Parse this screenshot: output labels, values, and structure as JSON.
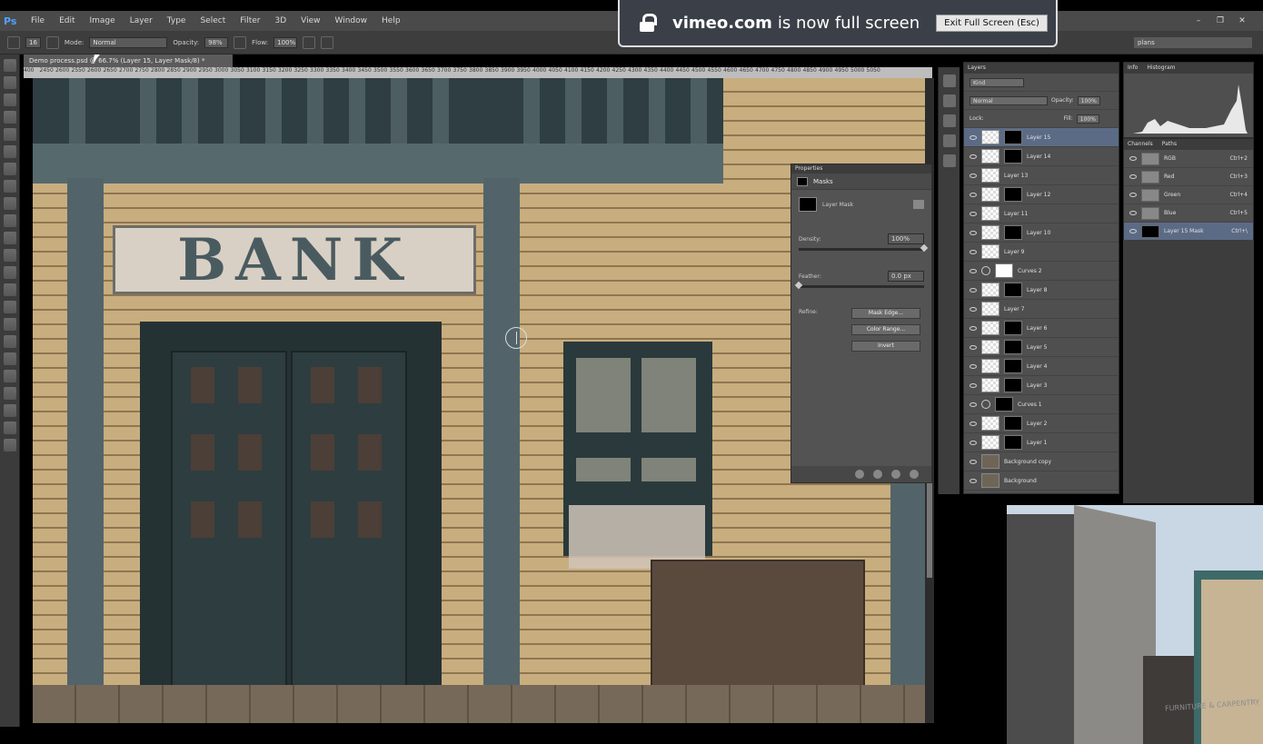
{
  "app": {
    "logo": "Ps",
    "menu": [
      "File",
      "Edit",
      "Image",
      "Layer",
      "Type",
      "Select",
      "Filter",
      "3D",
      "View",
      "Window",
      "Help"
    ],
    "window_controls": [
      "–",
      "❐",
      "✕"
    ]
  },
  "options_bar": {
    "brush_size": "16",
    "mode_label": "Mode:",
    "mode_value": "Normal",
    "opacity_label": "Opacity:",
    "opacity_value": "98%",
    "flow_label": "Flow:",
    "flow_value": "100%",
    "workspace": "plans"
  },
  "document": {
    "tab_label": "Demo process.psd @ 66.7% (Layer 15, Layer Mask/8) *",
    "ruler_ticks": [
      "400",
      "2450",
      "2600",
      "2550",
      "2600",
      "2650",
      "2700",
      "2750",
      "2800",
      "2850",
      "2900",
      "2950",
      "3000",
      "3050",
      "3100",
      "3150",
      "3200",
      "3250",
      "3300",
      "3350",
      "3400",
      "3450",
      "3500",
      "3550",
      "3600",
      "3650",
      "3700",
      "3750",
      "3800",
      "3850",
      "3900",
      "3950",
      "4000",
      "4050",
      "4100",
      "4150",
      "4200",
      "4250",
      "4300",
      "4350",
      "4400",
      "4450",
      "4500",
      "4550",
      "4600",
      "4650",
      "4700",
      "4750",
      "4800",
      "4850",
      "4900",
      "4950",
      "5000",
      "5050"
    ]
  },
  "canvas": {
    "sign_text": "BANK"
  },
  "properties": {
    "header": "Properties",
    "section": "Masks",
    "mask_label": "Layer Mask",
    "density_label": "Density:",
    "density_value": "100%",
    "density_level": 1.0,
    "feather_label": "Feather:",
    "feather_value": "0.0 px",
    "feather_level": 0.0,
    "refine_label": "Refine:",
    "buttons": [
      "Mask Edge...",
      "Color Range...",
      "Invert"
    ]
  },
  "layers_panel": {
    "tab": "Layers",
    "filter": "Kind",
    "blend_mode": "Normal",
    "opacity_label": "Opacity:",
    "opacity_value": "100%",
    "lock_label": "Lock:",
    "fill_label": "Fill:",
    "fill_value": "100%",
    "layers": [
      {
        "name": "Layer 15",
        "thumb": "transparent",
        "mask": "black",
        "selected": true
      },
      {
        "name": "Layer 14",
        "thumb": "transparent",
        "mask": "black"
      },
      {
        "name": "Layer 13",
        "thumb": "transparent",
        "mask": ""
      },
      {
        "name": "Layer 12",
        "thumb": "transparent",
        "mask": "black"
      },
      {
        "name": "Layer 11",
        "thumb": "transparent",
        "mask": ""
      },
      {
        "name": "Layer 10",
        "thumb": "transparent",
        "mask": "black"
      },
      {
        "name": "Layer 9",
        "thumb": "transparent",
        "mask": ""
      },
      {
        "name": "Curves 2",
        "thumb": "adjustment",
        "mask": "white"
      },
      {
        "name": "Layer 8",
        "thumb": "transparent",
        "mask": "black"
      },
      {
        "name": "Layer 7",
        "thumb": "transparent",
        "mask": ""
      },
      {
        "name": "Layer 6",
        "thumb": "transparent",
        "mask": "black"
      },
      {
        "name": "Layer 5",
        "thumb": "transparent",
        "mask": "black"
      },
      {
        "name": "Layer 4",
        "thumb": "transparent",
        "mask": "black"
      },
      {
        "name": "Layer 3",
        "thumb": "transparent",
        "mask": "black"
      },
      {
        "name": "Curves 1",
        "thumb": "adjustment",
        "mask": "black"
      },
      {
        "name": "Layer 2",
        "thumb": "transparent",
        "mask": "black"
      },
      {
        "name": "Layer 1",
        "thumb": "transparent",
        "mask": "black"
      },
      {
        "name": "Background copy",
        "thumb": "photo",
        "mask": ""
      },
      {
        "name": "Background",
        "thumb": "photo",
        "mask": ""
      }
    ]
  },
  "histogram_panel": {
    "tabs": [
      "Info",
      "Histogram"
    ]
  },
  "channels_panel": {
    "tabs": [
      "Channels",
      "Paths"
    ],
    "channels": [
      {
        "name": "RGB",
        "shortcut": "Ctrl+2"
      },
      {
        "name": "Red",
        "shortcut": "Ctrl+3"
      },
      {
        "name": "Green",
        "shortcut": "Ctrl+4"
      },
      {
        "name": "Blue",
        "shortcut": "Ctrl+5"
      },
      {
        "name": "Layer 15 Mask",
        "shortcut": "Ctrl+\\",
        "selected": true
      }
    ]
  },
  "vimeo_notice": {
    "domain": "vimeo.com",
    "message": "is now full screen",
    "exit_button": "Exit Full Screen (Esc)"
  },
  "reference_photo": {
    "sign_text": "FURNITURE & CARPENTRY"
  }
}
